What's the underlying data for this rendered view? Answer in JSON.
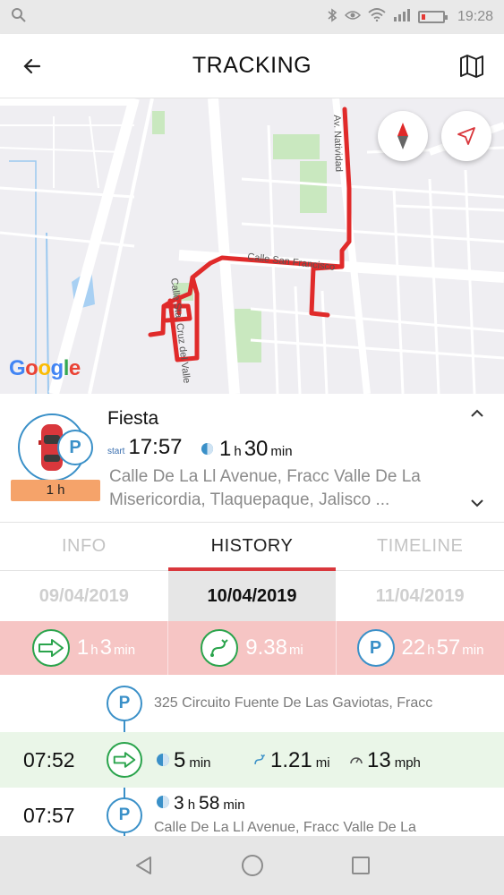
{
  "status_bar": {
    "time": "19:28"
  },
  "app_bar": {
    "title": "TRACKING"
  },
  "map": {
    "google_logo": "Google",
    "streets": [
      {
        "label": "Calle San Francisco"
      },
      {
        "label": "Calle Sta. Cruz del Valle"
      },
      {
        "label": "Av. Natividad"
      }
    ]
  },
  "vehicle": {
    "name": "Fiesta",
    "start_label": "start",
    "start_time": "17:57",
    "duration_hours": "1",
    "duration_hours_unit": "h",
    "duration_minutes": "30",
    "duration_minutes_unit": "min",
    "address": "Calle De La Ll Avenue, Fracc Valle De La Misericordia, Tlaquepaque, Jalisco ...",
    "badge": "1 h",
    "status_icon": "parking-icon"
  },
  "tabs": [
    {
      "label": "INFO"
    },
    {
      "label": "HISTORY"
    },
    {
      "label": "TIMELINE"
    }
  ],
  "dates": [
    {
      "label": "09/04/2019"
    },
    {
      "label": "10/04/2019"
    },
    {
      "label": "11/04/2019"
    }
  ],
  "summary": {
    "driving": {
      "hours": "1",
      "hours_unit": "h",
      "minutes": "3",
      "minutes_unit": "min"
    },
    "distance": {
      "value": "9.38",
      "unit": "mi"
    },
    "parked": {
      "hours": "22",
      "hours_unit": "h",
      "minutes": "57",
      "minutes_unit": "min"
    }
  },
  "timeline": {
    "row1": {
      "address": "325 Circuito Fuente De Las Gaviotas, Fracc"
    },
    "row2": {
      "time": "07:52",
      "duration": "5",
      "duration_unit": "min",
      "distance": "1.21",
      "distance_unit": "mi",
      "speed": "13",
      "speed_unit": "mph"
    },
    "row3": {
      "time": "07:57",
      "hours": "3",
      "hours_unit": "h",
      "minutes": "58",
      "minutes_unit": "min",
      "address": "Calle De La Ll Avenue, Fracc Valle De La"
    }
  },
  "colors": {
    "accent_red": "#d9373c",
    "parking_blue": "#3a90c8",
    "driving_green": "#2aa44c",
    "summary_bg": "#f6c5c4",
    "badge_orange": "#f5a36a"
  }
}
